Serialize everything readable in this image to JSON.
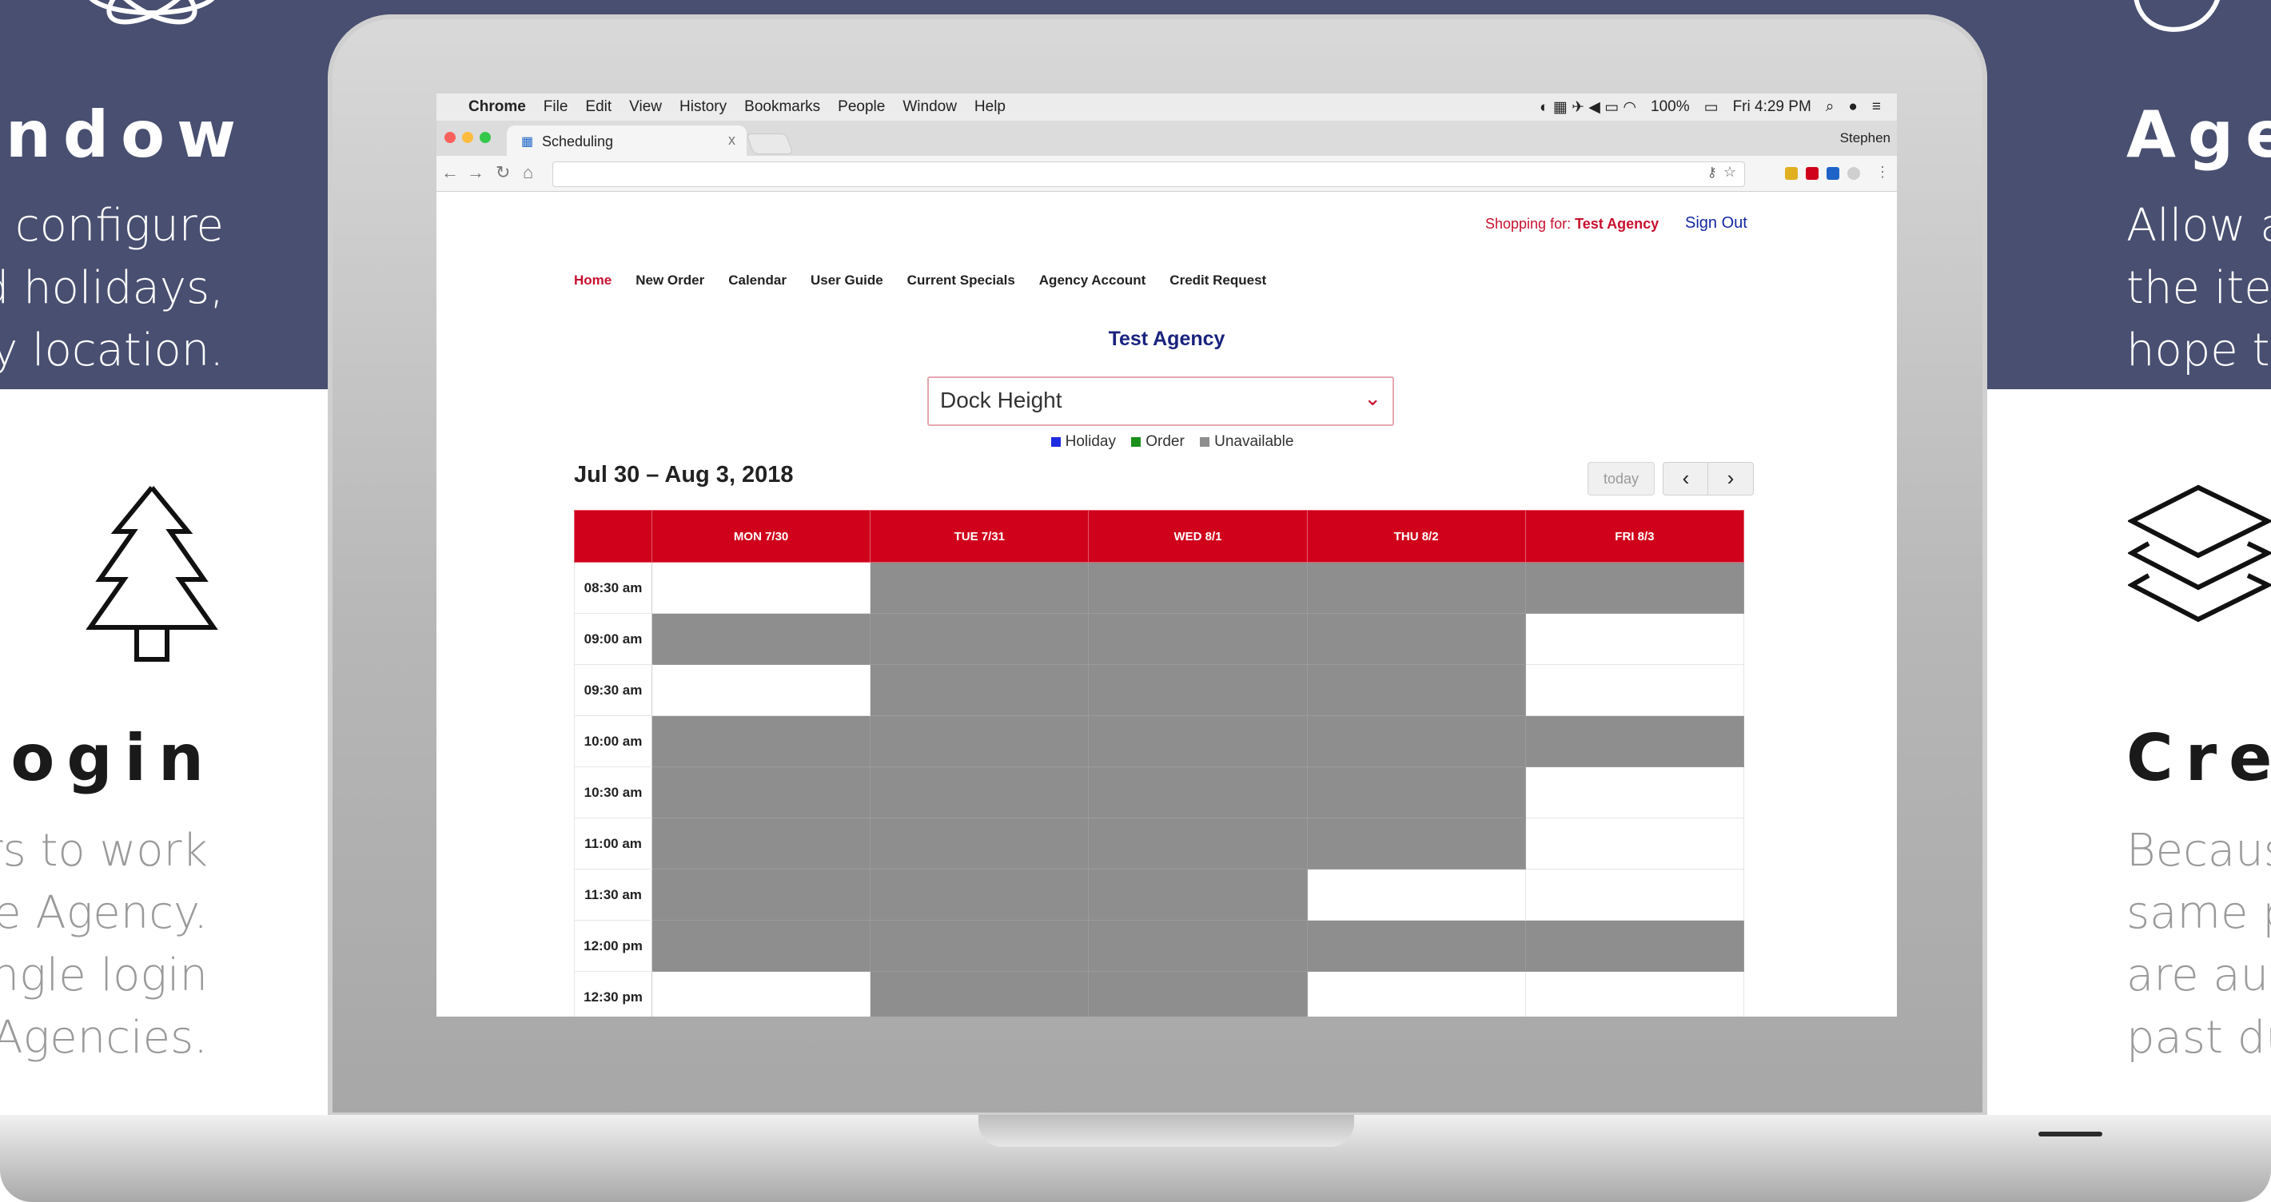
{
  "colors": {
    "band": "#484f70",
    "brand_red": "#c8102e",
    "calendar_header": "#d0021b",
    "unavailable": "#8e8e8e",
    "holiday": "#1e2be0",
    "order": "#1a8f1a"
  },
  "left_features": [
    {
      "icon": "atom-icon",
      "title": "ndow",
      "desc": "y configure\nd holidays,\ny location."
    },
    {
      "icon": "pine-tree-icon",
      "title": "Login",
      "desc": "rs to work\ne Agency.\nngle login\nAgencies."
    }
  ],
  "right_features": [
    {
      "icon": "leaf-icon",
      "title": "Age",
      "desc": "Allow a\nthe ite\nhope t"
    },
    {
      "icon": "layers-icon",
      "title": "Cre",
      "desc": "Becaus\nsame p\nare aut\npast du"
    }
  ],
  "menubar": {
    "items": [
      "Chrome",
      "File",
      "Edit",
      "View",
      "History",
      "Bookmarks",
      "People",
      "Window",
      "Help"
    ],
    "battery": "100%",
    "clock": "Fri 4:29 PM"
  },
  "browser": {
    "tab_title": "Scheduling",
    "tab_close": "x",
    "profile": "Stephen",
    "url": ""
  },
  "page": {
    "shopping_label": "Shopping for:",
    "shopping_agency": "Test Agency",
    "sign_out": "Sign Out",
    "nav": [
      "Home",
      "New Order",
      "Calendar",
      "User Guide",
      "Current Specials",
      "Agency Account",
      "Credit Request"
    ],
    "agency_title": "Test Agency",
    "location_select": "Dock Height",
    "legend": [
      "Holiday",
      "Order",
      "Unavailable"
    ],
    "range_title": "Jul 30 – Aug 3, 2018",
    "today_label": "today",
    "prev_label": "‹",
    "next_label": "›"
  },
  "calendar": {
    "days": [
      "MON 7/30",
      "TUE 7/31",
      "WED 8/1",
      "THU 8/2",
      "FRI 8/3"
    ],
    "rows": [
      {
        "time": "08:30 am",
        "slots": [
          "free",
          "busy",
          "busy",
          "busy",
          "busy"
        ]
      },
      {
        "time": "09:00 am",
        "slots": [
          "busy",
          "busy",
          "busy",
          "busy",
          "free"
        ]
      },
      {
        "time": "09:30 am",
        "slots": [
          "free",
          "busy",
          "busy",
          "busy",
          "free"
        ]
      },
      {
        "time": "10:00 am",
        "slots": [
          "busy",
          "busy",
          "busy",
          "busy",
          "busy"
        ]
      },
      {
        "time": "10:30 am",
        "slots": [
          "busy",
          "busy",
          "busy",
          "busy",
          "free"
        ]
      },
      {
        "time": "11:00 am",
        "slots": [
          "busy",
          "busy",
          "busy",
          "busy",
          "free"
        ]
      },
      {
        "time": "11:30 am",
        "slots": [
          "busy",
          "busy",
          "busy",
          "free",
          "free"
        ]
      },
      {
        "time": "12:00 pm",
        "slots": [
          "busy",
          "busy",
          "busy",
          "busy",
          "busy"
        ]
      },
      {
        "time": "12:30 pm",
        "slots": [
          "free",
          "busy",
          "busy",
          "free",
          "free"
        ]
      }
    ]
  }
}
